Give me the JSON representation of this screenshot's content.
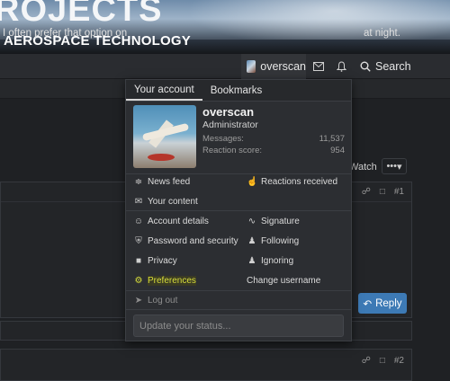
{
  "banner": {
    "logo_partial": "ROJECTS",
    "subtitle": "AEROSPACE TECHNOLOGY"
  },
  "navbar": {
    "username": "overscan",
    "search_label": "Search",
    "icons": [
      "mail-icon",
      "bell-icon",
      "search-icon"
    ]
  },
  "thread": {
    "watch_label": "Watch",
    "more_label": "•••"
  },
  "posts": [
    {
      "number": "#1",
      "text_left": "I often prefer that option on",
      "text_right": "at night.",
      "reply_label": "Reply"
    },
    {
      "number": "#2"
    }
  ],
  "account_menu": {
    "tabs": [
      "Your account",
      "Bookmarks"
    ],
    "profile": {
      "username": "overscan",
      "role": "Administrator",
      "messages_label": "Messages:",
      "messages_value": "11,537",
      "reaction_label": "Reaction score:",
      "reaction_value": "954"
    },
    "links": {
      "news_feed": "News feed",
      "reactions_received": "Reactions received",
      "your_content": "Your content",
      "account_details": "Account details",
      "signature": "Signature",
      "password_security": "Password and security",
      "following": "Following",
      "privacy": "Privacy",
      "ignoring": "Ignoring",
      "preferences": "Preferences",
      "change_username": "Change username",
      "log_out": "Log out"
    },
    "status_placeholder": "Update your status..."
  },
  "colors": {
    "highlight": "#d8de3a",
    "reply_button": "#3d7ab5",
    "background": "#1f2124"
  }
}
